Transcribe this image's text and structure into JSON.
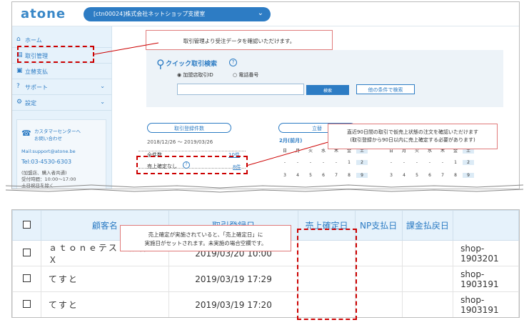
{
  "header": {
    "logo": "atone",
    "shop_select": "[ctn00024]株式会社ネットショップ支援室"
  },
  "sidebar": {
    "items": [
      {
        "label": "ホーム",
        "icon": "home-icon"
      },
      {
        "label": "取引管理",
        "icon": "cart-icon"
      },
      {
        "label": "立替支払",
        "icon": "yen-icon"
      },
      {
        "label": "サポート",
        "icon": "help-icon"
      },
      {
        "label": "設定",
        "icon": "gear-icon"
      }
    ],
    "support": {
      "title1": "カスタマーセンターへ",
      "title2": "お問い合わせ",
      "mail": "Mail:support@atone.be",
      "tel": "Tel:03-4530-6303",
      "note1": "(加盟店、購入者共通)",
      "note2": "受付時間：10:00～17:00",
      "note3": "土日祝日を除く"
    }
  },
  "quick_search": {
    "title": "クイック取引検索",
    "radio1": "加盟店取引ID",
    "radio2": "電話番号",
    "search_button": "検索",
    "other_button": "他の条件で検索"
  },
  "stats": {
    "pill_left": "取引登録件数",
    "pill_mid": "立替",
    "range": "2018/12/26 ～ 2019/03/26",
    "total_label": "全件数",
    "total_value": "10件",
    "unconfirmed_label": "売上確定なし",
    "unconfirmed_value": "8件",
    "month": "2月(前月)",
    "weekdays": [
      "日",
      "月",
      "火",
      "水",
      "木",
      "金",
      "土"
    ],
    "row1": [
      "-",
      "-",
      "-",
      "-",
      "-",
      "1",
      "2"
    ],
    "row2": [
      "3",
      "4",
      "5",
      "6",
      "7",
      "8",
      "9"
    ],
    "row1b": [
      "-",
      "-",
      "-",
      "-",
      "-",
      "1",
      "2"
    ],
    "row2b": [
      "3",
      "4",
      "5",
      "6",
      "7",
      "8",
      "9"
    ]
  },
  "callouts": {
    "c1": "取引管理より受注データを確認いただけます。",
    "c2_line1": "直近90日間の取引で仮売上状態の注文を確認いただけます",
    "c2_line2": "(取引登録から90日以内に売上確定する必要があります)",
    "c3_line1": "売上確定が実施されていると、「売上確定日」に",
    "c3_line2": "実施日がセットされます。未実施の場合空欄です。"
  },
  "table": {
    "headers": [
      "顧客名",
      "取引登録日",
      "売上確定日",
      "NP支払日",
      "課金払戻日"
    ],
    "rows": [
      {
        "name": "ａｔｏｎｅテスト顧客ＸＸＸ",
        "date": "2019/03/20 10:00",
        "shop": "shop-1903201"
      },
      {
        "name": "てすと",
        "date": "2019/03/19 17:29",
        "shop": "shop-1903191"
      },
      {
        "name": "てすと",
        "date": "2019/03/19 17:20",
        "shop": "shop-1903191"
      }
    ]
  }
}
